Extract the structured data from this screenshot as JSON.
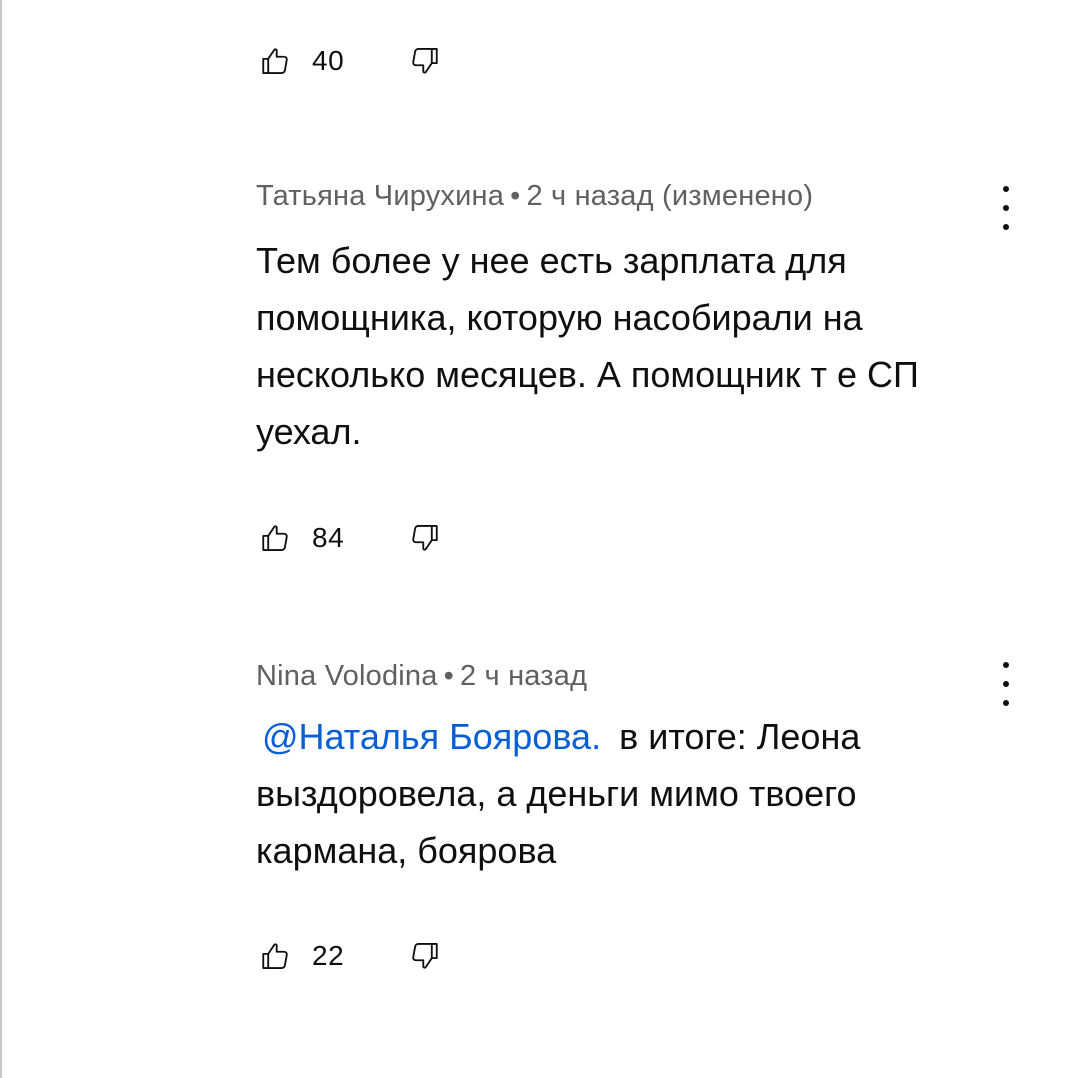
{
  "top_comment_actions": {
    "like_count": "40"
  },
  "comments": [
    {
      "author": "Татьяна Чирухина",
      "separator": "•",
      "time": "2 ч назад (изменено)",
      "text": "Тем более у нее есть зарплата для помощника, которую насобирали на несколько месяцев. А помощник т е СП уехал.",
      "like_count": "84"
    },
    {
      "author": "Nina Volodina",
      "separator": "•",
      "time": "2 ч назад",
      "mention": "@Наталья Боярова.",
      "text": "в итоге: Леона выздоровела, а деньги мимо твоего кармана, боярова",
      "like_count": "22"
    }
  ],
  "icons": {
    "like": "thumbs-up-icon",
    "dislike": "thumbs-down-icon",
    "menu": "more-vert-icon"
  },
  "colors": {
    "meta": "#606060",
    "text": "#0f0f0f",
    "mention": "#065fd4"
  }
}
